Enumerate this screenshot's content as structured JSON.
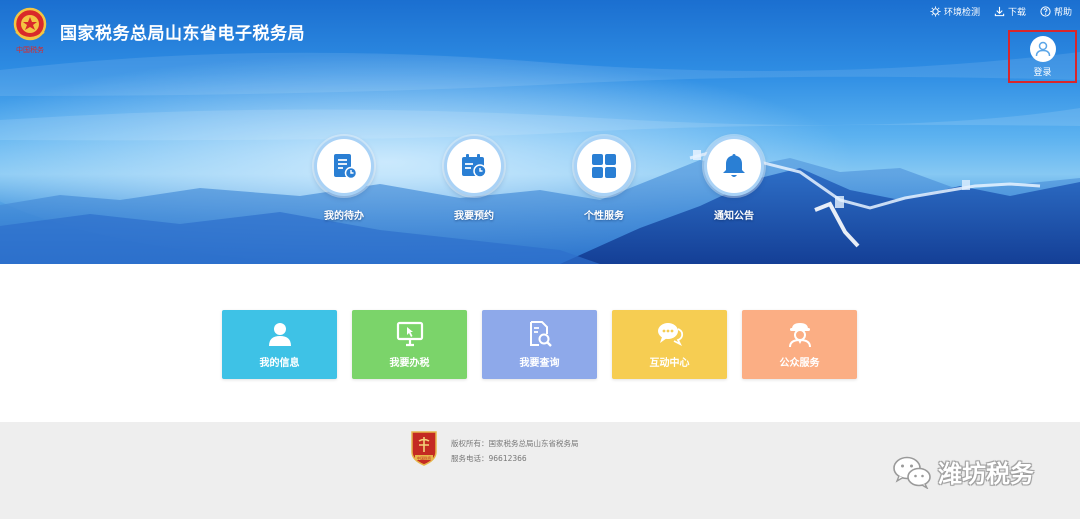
{
  "header": {
    "site_title": "国家税务总局山东省电子税务局",
    "emblem_caption": "中国税务",
    "top_links": [
      {
        "label": "环境检测",
        "icon": "gear-icon"
      },
      {
        "label": "下载",
        "icon": "download-icon"
      },
      {
        "label": "帮助",
        "icon": "help-icon"
      }
    ],
    "login_label": "登录"
  },
  "banner_nav": [
    {
      "label": "我的待办",
      "icon": "todo-document-icon"
    },
    {
      "label": "我要预约",
      "icon": "calendar-clock-icon"
    },
    {
      "label": "个性服务",
      "icon": "grid-icon"
    },
    {
      "label": "通知公告",
      "icon": "bell-icon"
    }
  ],
  "tiles": [
    {
      "label": "我的信息",
      "icon": "user-icon",
      "color": "#3ec2e6"
    },
    {
      "label": "我要办税",
      "icon": "monitor-cursor-icon",
      "color": "#7bd46a"
    },
    {
      "label": "我要查询",
      "icon": "document-search-icon",
      "color": "#8ea9ea"
    },
    {
      "label": "互动中心",
      "icon": "chat-bubbles-icon",
      "color": "#f6cd52"
    },
    {
      "label": "公众服务",
      "icon": "service-person-icon",
      "color": "#fbae84"
    }
  ],
  "footer": {
    "copyright": "版权所有：国家税务总局山东省税务局",
    "phone": "服务电话：96612366",
    "badge_caption": "中国税务"
  },
  "watermark": {
    "text": "潍坊税务",
    "icon": "wechat-icon"
  },
  "colors": {
    "login_highlight": "#d8262c",
    "nav_icon": "#2a7fd4",
    "footer_bg": "#eeeeee"
  }
}
